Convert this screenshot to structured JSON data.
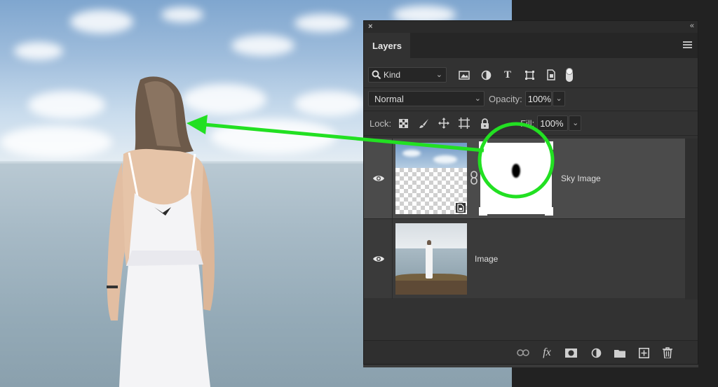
{
  "panel": {
    "tab_label": "Layers",
    "close_glyph": "×",
    "collapse_glyph": "«"
  },
  "filter": {
    "kind_label": "Kind"
  },
  "blend": {
    "mode": "Normal",
    "opacity_label": "Opacity:",
    "opacity_value": "100%"
  },
  "lock": {
    "lock_label": "Lock:",
    "fill_label": "Fill:",
    "fill_value": "100%"
  },
  "layers": [
    {
      "name": "Sky Image",
      "visible": true,
      "selected": true,
      "has_mask": true
    },
    {
      "name": "Image",
      "visible": true,
      "selected": false,
      "has_mask": false
    }
  ],
  "bottom_bar": {
    "fx_label": "fx"
  },
  "colors": {
    "annotation_green": "#22e022",
    "panel_bg": "#323232",
    "selected_layer_bg": "#4b4b4b"
  }
}
